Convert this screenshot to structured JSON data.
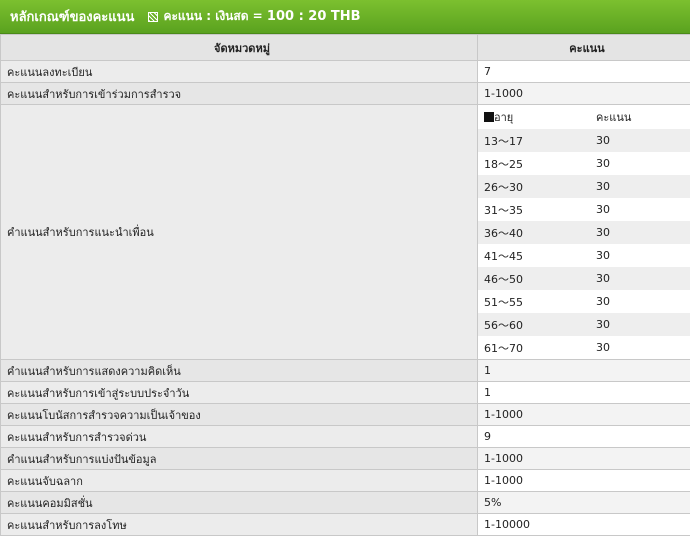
{
  "header": {
    "title": "หลักเกณฑ์ของคะแนน",
    "ratio_label": "คะแนน : เงินสด =",
    "ratio_value": "100 : 20 THB"
  },
  "table": {
    "col_category": "จัดหมวดหมู่",
    "col_points": "คะแนน",
    "rows_before": [
      {
        "category": "คะแนนลงทะเบียน",
        "points": "7"
      },
      {
        "category": "คะแนนสำหรับการเข้าร่วมการสำรวจ",
        "points": "1-1000"
      }
    ],
    "referral": {
      "category": "คำแนนสำหรับการแนะนำเพื่อน",
      "age_header": "อายุ",
      "points_header": "คะแนน",
      "ages": [
        {
          "range": "13～17",
          "points": "30"
        },
        {
          "range": "18～25",
          "points": "30"
        },
        {
          "range": "26～30",
          "points": "30"
        },
        {
          "range": "31～35",
          "points": "30"
        },
        {
          "range": "36～40",
          "points": "30"
        },
        {
          "range": "41～45",
          "points": "30"
        },
        {
          "range": "46～50",
          "points": "30"
        },
        {
          "range": "51～55",
          "points": "30"
        },
        {
          "range": "56～60",
          "points": "30"
        },
        {
          "range": "61～70",
          "points": "30"
        }
      ]
    },
    "rows_after": [
      {
        "category": "คำแนนสำหรับการแสดงความคิดเห็น",
        "points": "1"
      },
      {
        "category": "คะแนนสำหรับการเข้าสู่ระบบประจำวัน",
        "points": "1"
      },
      {
        "category": "คะแนนโบนัสการสำรวจความเป็นเจ้าของ",
        "points": "1-1000"
      },
      {
        "category": "คะแนนสำหรับการสำรวจด่วน",
        "points": "9"
      },
      {
        "category": "คำแนนสำหรับการแบ่งปันข้อมูล",
        "points": "1-1000"
      },
      {
        "category": "คะแนนจับฉลาก",
        "points": "1-1000"
      },
      {
        "category": "คะแนนคอมมิสชั่น",
        "points": "5%"
      },
      {
        "category": "คะแนนสำหรับการลงโทษ",
        "points": "1-10000"
      }
    ]
  }
}
